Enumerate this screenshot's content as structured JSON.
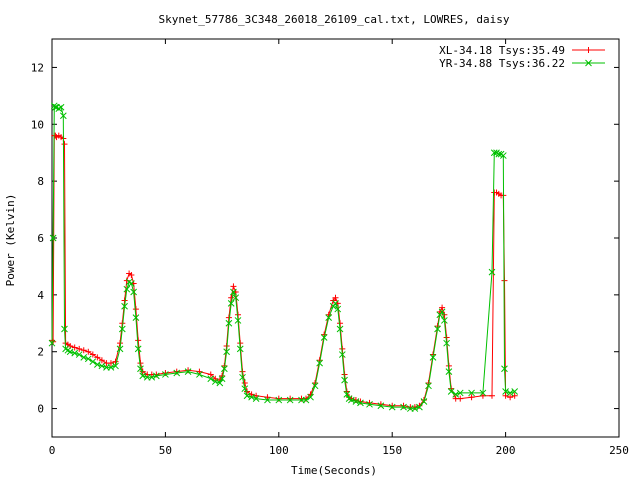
{
  "chart_data": {
    "type": "line",
    "title": "Skynet_57786_3C348_26018_26109_cal.txt, LOWRES, daisy",
    "xlabel": "Time(Seconds)",
    "ylabel": "Power (Kelvin)",
    "xlim": [
      0,
      250
    ],
    "ylim": [
      -1,
      13
    ],
    "xticks": [
      0,
      50,
      100,
      150,
      200,
      250
    ],
    "yticks": [
      0,
      2,
      4,
      6,
      8,
      10,
      12
    ],
    "grid": false,
    "legend_position": "top-right",
    "series": [
      {
        "name": "XL-34.18 Tsys:35.49",
        "color": "#ff0000",
        "marker": "plus",
        "x": [
          0,
          0.5,
          1,
          1.5,
          2,
          3,
          4,
          5,
          5.5,
          6,
          7,
          8,
          10,
          12,
          14,
          16,
          18,
          20,
          22,
          24,
          26,
          28,
          30,
          31,
          32,
          33,
          34,
          35,
          36,
          37,
          38,
          39,
          40,
          42,
          44,
          46,
          50,
          55,
          60,
          65,
          70,
          72,
          74,
          75,
          76,
          77,
          78,
          79,
          80,
          81,
          82,
          83,
          84,
          85,
          86,
          88,
          90,
          95,
          100,
          105,
          110,
          112,
          114,
          116,
          118,
          120,
          122,
          124,
          125,
          126,
          127,
          128,
          129,
          130,
          131,
          132,
          134,
          136,
          140,
          145,
          150,
          155,
          158,
          160,
          162,
          164,
          166,
          168,
          170,
          171,
          172,
          173,
          174,
          175,
          176,
          178,
          180,
          185,
          190,
          194,
          195,
          196,
          197,
          198,
          199,
          199.5,
          200,
          202,
          204
        ],
        "y": [
          2.4,
          2.35,
          9.6,
          9.6,
          9.55,
          9.6,
          9.55,
          9.5,
          9.3,
          2.3,
          2.25,
          2.2,
          2.15,
          2.1,
          2.05,
          2.0,
          1.9,
          1.8,
          1.7,
          1.6,
          1.6,
          1.65,
          2.3,
          3.0,
          3.8,
          4.5,
          4.75,
          4.7,
          4.4,
          3.5,
          2.4,
          1.6,
          1.3,
          1.2,
          1.2,
          1.2,
          1.25,
          1.3,
          1.35,
          1.3,
          1.2,
          1.05,
          1.0,
          1.15,
          1.5,
          2.2,
          3.2,
          3.9,
          4.3,
          4.1,
          3.3,
          2.3,
          1.3,
          0.9,
          0.6,
          0.5,
          0.45,
          0.4,
          0.35,
          0.35,
          0.35,
          0.35,
          0.5,
          0.9,
          1.7,
          2.6,
          3.3,
          3.8,
          3.9,
          3.7,
          3.0,
          2.1,
          1.2,
          0.6,
          0.4,
          0.35,
          0.3,
          0.25,
          0.2,
          0.15,
          0.1,
          0.1,
          0.05,
          0.05,
          0.1,
          0.3,
          0.9,
          1.9,
          2.9,
          3.4,
          3.55,
          3.3,
          2.5,
          1.5,
          0.7,
          0.35,
          0.35,
          0.4,
          0.45,
          0.45,
          7.6,
          7.6,
          7.55,
          7.5,
          7.5,
          4.5,
          0.45,
          0.4,
          0.45
        ]
      },
      {
        "name": "YR-34.88 Tsys:36.22",
        "color": "#00c000",
        "marker": "cross",
        "x": [
          0,
          0.5,
          1,
          1.5,
          2,
          3,
          4,
          5,
          5.5,
          6,
          7,
          8,
          10,
          12,
          14,
          16,
          18,
          20,
          22,
          24,
          26,
          28,
          30,
          31,
          32,
          33,
          34,
          35,
          36,
          37,
          38,
          39,
          40,
          42,
          44,
          46,
          50,
          55,
          60,
          65,
          70,
          72,
          74,
          75,
          76,
          77,
          78,
          79,
          80,
          81,
          82,
          83,
          84,
          85,
          86,
          88,
          90,
          95,
          100,
          105,
          110,
          112,
          114,
          116,
          118,
          120,
          122,
          124,
          125,
          126,
          127,
          128,
          129,
          130,
          131,
          132,
          134,
          136,
          140,
          145,
          150,
          155,
          158,
          160,
          162,
          164,
          166,
          168,
          170,
          171,
          172,
          173,
          174,
          175,
          176,
          178,
          180,
          185,
          190,
          194,
          195,
          196,
          197,
          198,
          199,
          199.5,
          200,
          202,
          204
        ],
        "y": [
          2.3,
          6.0,
          10.65,
          10.6,
          10.6,
          10.55,
          10.6,
          10.3,
          2.8,
          2.1,
          2.05,
          2.0,
          1.95,
          1.9,
          1.8,
          1.75,
          1.65,
          1.55,
          1.5,
          1.45,
          1.45,
          1.5,
          2.1,
          2.8,
          3.6,
          4.2,
          4.45,
          4.4,
          4.1,
          3.2,
          2.1,
          1.4,
          1.15,
          1.1,
          1.1,
          1.15,
          1.2,
          1.25,
          1.3,
          1.2,
          1.05,
          0.95,
          0.9,
          1.05,
          1.4,
          2.0,
          3.0,
          3.7,
          4.1,
          3.9,
          3.1,
          2.1,
          1.1,
          0.7,
          0.45,
          0.4,
          0.35,
          0.3,
          0.3,
          0.3,
          0.3,
          0.3,
          0.4,
          0.8,
          1.6,
          2.5,
          3.2,
          3.6,
          3.7,
          3.5,
          2.8,
          1.9,
          1.0,
          0.5,
          0.35,
          0.3,
          0.25,
          0.2,
          0.15,
          0.1,
          0.05,
          0.05,
          0.0,
          0.0,
          0.05,
          0.25,
          0.8,
          1.8,
          2.8,
          3.3,
          3.4,
          3.1,
          2.3,
          1.3,
          0.6,
          0.5,
          0.55,
          0.55,
          0.55,
          4.8,
          9.0,
          9.0,
          8.95,
          8.95,
          8.9,
          1.4,
          0.6,
          0.55,
          0.6
        ]
      }
    ]
  }
}
